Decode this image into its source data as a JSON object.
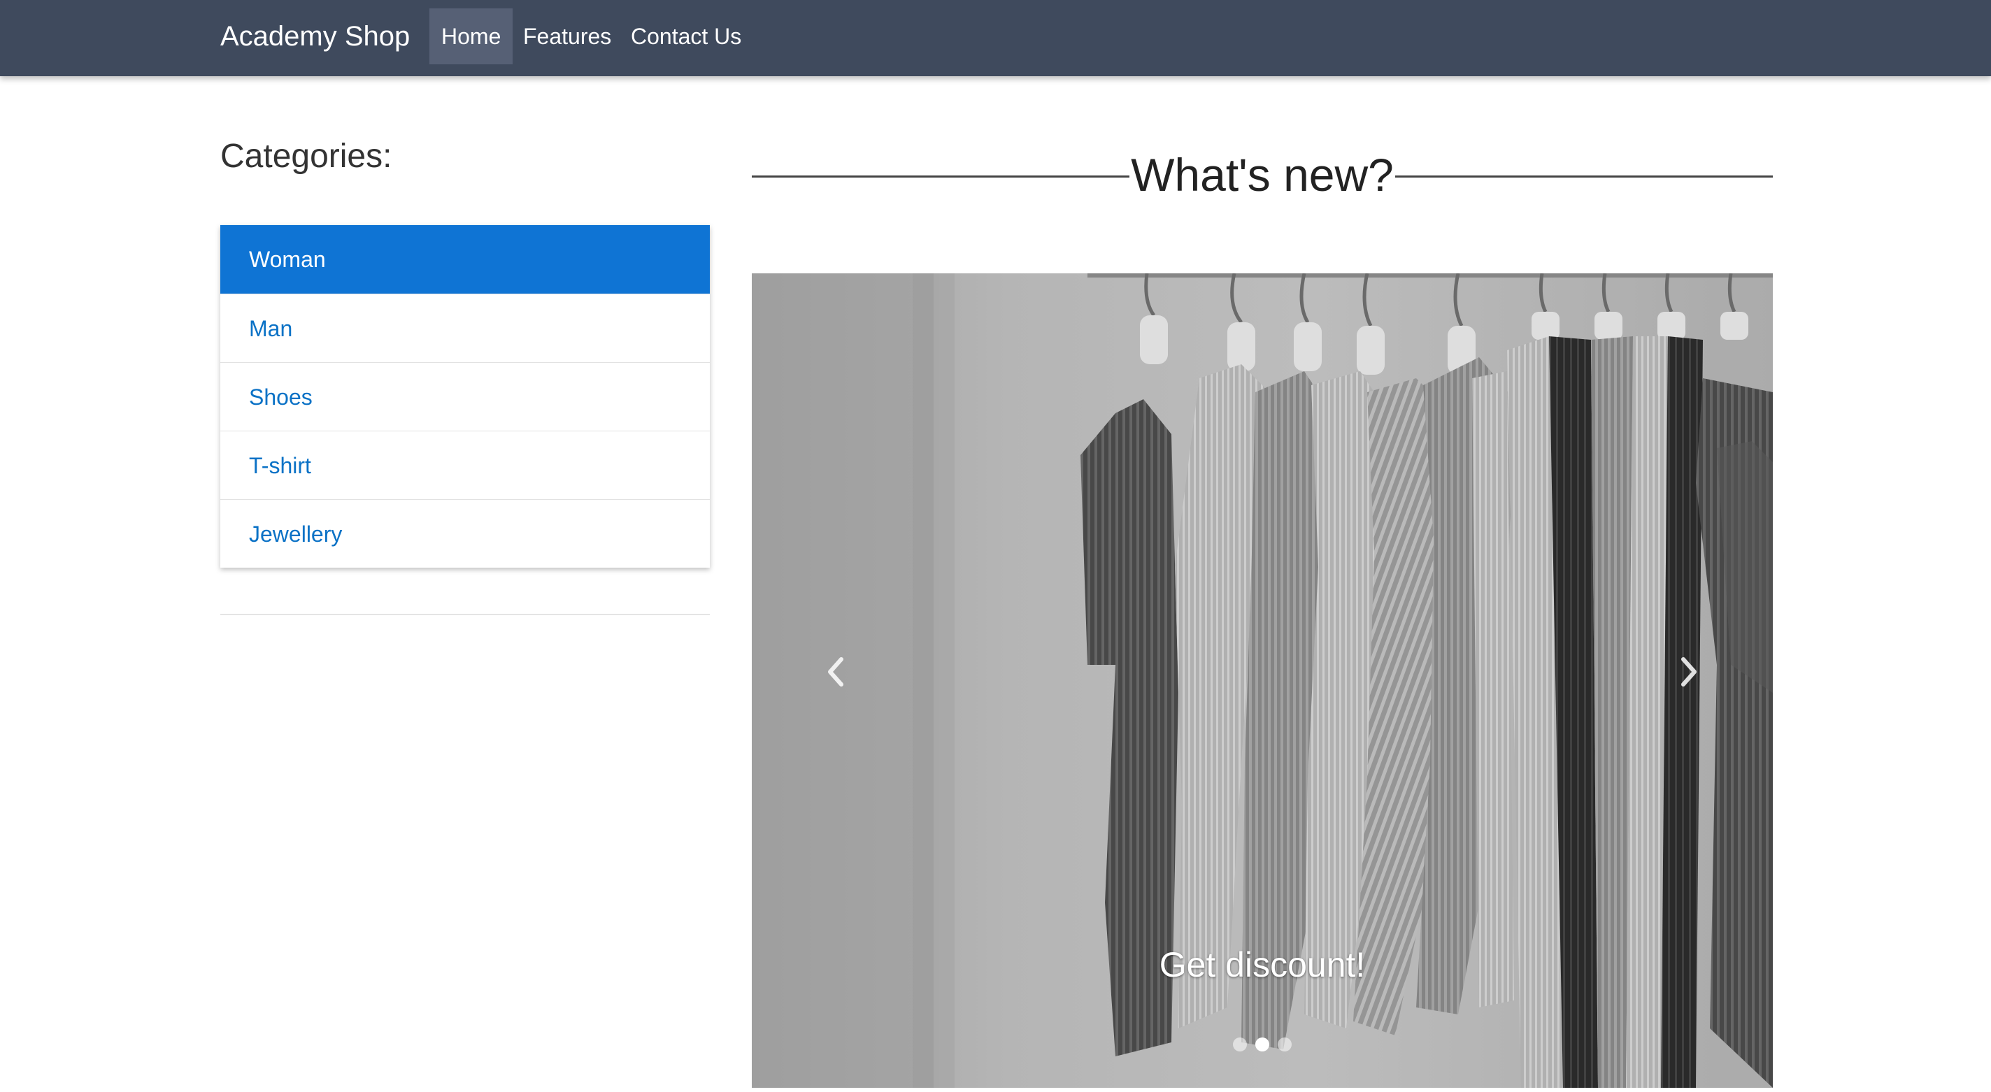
{
  "navbar": {
    "brand": "Academy Shop",
    "items": [
      {
        "label": "Home",
        "active": true
      },
      {
        "label": "Features",
        "active": false
      },
      {
        "label": "Contact Us",
        "active": false
      }
    ]
  },
  "sidebar": {
    "title": "Categories:",
    "categories": [
      {
        "label": "Woman",
        "active": true
      },
      {
        "label": "Man",
        "active": false
      },
      {
        "label": "Shoes",
        "active": false
      },
      {
        "label": "T-shirt",
        "active": false
      },
      {
        "label": "Jewellery",
        "active": false
      }
    ]
  },
  "main": {
    "section_title": "What's new?",
    "carousel": {
      "caption": "Get discount!",
      "slide_count": 3,
      "active_slide": 2,
      "prev_icon": "chevron-left-icon",
      "next_icon": "chevron-right-icon"
    }
  },
  "colors": {
    "navbar_bg": "#3f4a5d",
    "nav_active_bg": "#566075",
    "accent": "#0f74d4",
    "link": "#0b72c6"
  }
}
